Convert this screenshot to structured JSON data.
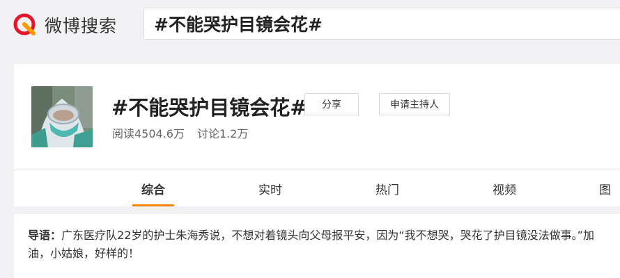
{
  "header": {
    "logo_text": "微博搜索",
    "search_value": "#不能哭护目镜会花#"
  },
  "topic": {
    "title": "#不能哭护目镜会花#",
    "share_label": "分享",
    "host_label": "申请主持人",
    "read_count": "阅读4504.6万",
    "discuss_count": "讨论1.2万"
  },
  "tabs": [
    {
      "label": "综合",
      "active": true
    },
    {
      "label": "实时"
    },
    {
      "label": "热门"
    },
    {
      "label": "视频"
    },
    {
      "label": "图"
    }
  ],
  "guide": {
    "label": "导语：",
    "text": "广东医疗队22岁的护士朱海秀说，不想对着镜头向父母报平安，因为“我不想哭，哭花了护目镜没法做事。”加油，小姑娘，好样的！"
  },
  "colors": {
    "accent": "#ff8200",
    "logo_red": "#e6162d",
    "logo_orange": "#ff9900"
  },
  "icons": {
    "logo": "weibo-search-logo-icon"
  }
}
